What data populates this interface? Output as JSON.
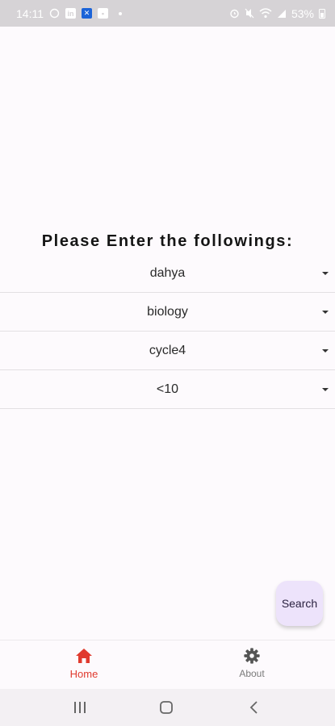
{
  "status_bar": {
    "time": "14:11",
    "battery": "53%",
    "left_icons": [
      "whatsapp-icon",
      "linkedin-icon",
      "x-app-icon",
      "app-icon",
      "dot-icon"
    ],
    "right_icons": [
      "alarm-icon",
      "mute-icon",
      "wifi-icon",
      "signal-icon"
    ]
  },
  "form": {
    "title": "Please Enter the followings:",
    "dropdowns": [
      {
        "value": "dahya"
      },
      {
        "value": "biology"
      },
      {
        "value": "cycle4"
      },
      {
        "value": "<10"
      }
    ]
  },
  "fab": {
    "label": "Search"
  },
  "bottom_nav": {
    "items": [
      {
        "label": "Home",
        "icon": "home-icon",
        "active": true
      },
      {
        "label": "About",
        "icon": "gear-icon",
        "active": false
      }
    ]
  },
  "colors": {
    "accent": "#e03a2e",
    "fab_bg": "#ede3fb",
    "background": "#fdfafd"
  }
}
